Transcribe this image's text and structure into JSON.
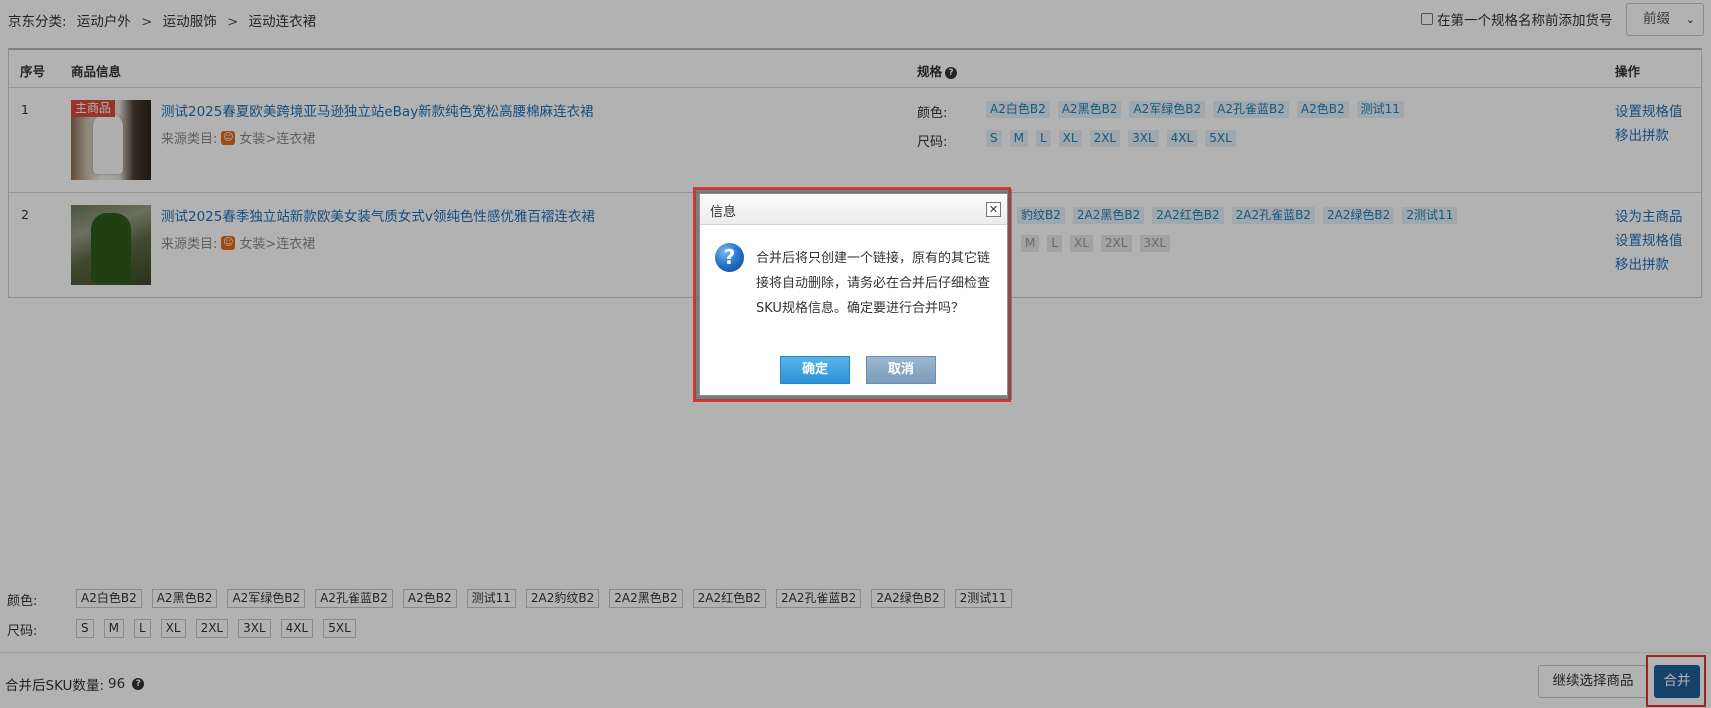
{
  "breadcrumb": {
    "prefix": "京东分类:",
    "items": [
      "运动户外",
      "运动服饰",
      "运动连衣裙"
    ],
    "separator": ">"
  },
  "prefix_option": {
    "checkbox_label": "在第一个规格名称前添加货号",
    "checked": false,
    "select_value": "前缀"
  },
  "table": {
    "headers": {
      "index": "序号",
      "product": "商品信息",
      "spec": "规格",
      "action": "操作"
    },
    "rows": [
      {
        "index": "1",
        "main_tag": "主商品",
        "title": "测试2025春夏欧美跨境亚马逊独立站eBay新款纯色宽松高腰棉麻连衣裙",
        "source_label": "来源类目:",
        "source_value": "女装>连衣裙",
        "color_label": "颜色:",
        "colors": [
          "A2白色B2",
          "A2黑色B2",
          "A2军绿色B2",
          "A2孔雀蓝B2",
          "A2色B2",
          "测试11"
        ],
        "size_label": "尺码:",
        "sizes": [
          "S",
          "M",
          "L",
          "XL",
          "2XL",
          "3XL",
          "4XL",
          "5XL"
        ],
        "actions": [
          "设置规格值",
          "移出拼款"
        ]
      },
      {
        "index": "2",
        "title": "测试2025春季独立站新款欧美女装气质女式v领纯色性感优雅百褶连衣裙",
        "source_label": "来源类目:",
        "source_value": "女装>连衣裙",
        "colors": [
          "豹纹B2",
          "2A2黑色B2",
          "2A2红色B2",
          "2A2孔雀蓝B2",
          "2A2绿色B2",
          "2测试11"
        ],
        "sizes": [
          "M",
          "L",
          "XL",
          "2XL",
          "3XL"
        ],
        "actions": [
          "设为主商品",
          "设置规格值",
          "移出拼款"
        ]
      }
    ]
  },
  "summary": {
    "color_label": "颜色:",
    "colors": [
      "A2白色B2",
      "A2黑色B2",
      "A2军绿色B2",
      "A2孔雀蓝B2",
      "A2色B2",
      "测试11",
      "2A2豹纹B2",
      "2A2黑色B2",
      "2A2红色B2",
      "2A2孔雀蓝B2",
      "2A2绿色B2",
      "2测试11"
    ],
    "size_label": "尺码:",
    "sizes": [
      "S",
      "M",
      "L",
      "XL",
      "2XL",
      "3XL",
      "4XL",
      "5XL"
    ],
    "sku_label": "合并后SKU数量:",
    "sku_count": "96"
  },
  "buttons": {
    "continue": "继续选择商品",
    "merge": "合并"
  },
  "dialog": {
    "title": "信息",
    "message": "合并后将只创建一个链接，原有的其它链接将自动删除，请务必在合并后仔细检查SKU规格信息。确定要进行合并吗？",
    "ok": "确定",
    "cancel": "取消"
  },
  "colors": {
    "link": "#1d6fb8",
    "chip_bg": "#e6f1f8",
    "highlight": "#e2322f",
    "merge_button": "#1f5e99",
    "main_tag": "#d94a3a"
  },
  "icons": {
    "help": "question-circle-icon",
    "source": "taobao-icon",
    "close": "close-icon",
    "question": "question-icon",
    "dropdown": "chevron-down-icon"
  }
}
